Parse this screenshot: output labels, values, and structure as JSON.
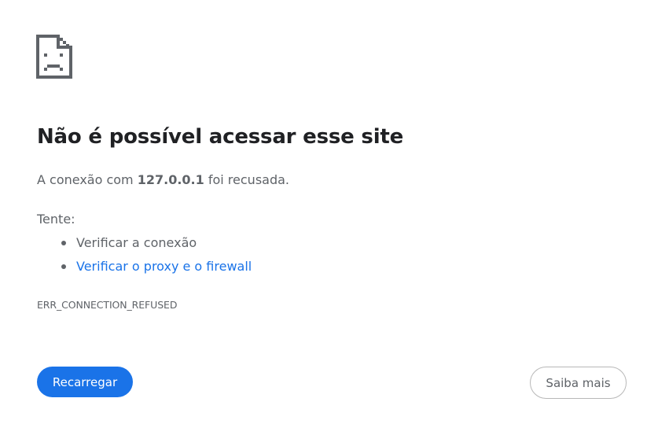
{
  "error_icon": "sad-page-icon",
  "heading": "Não é possível acessar esse site",
  "summary": {
    "prefix": "A conexão com ",
    "host": "127.0.0.1",
    "suffix": " foi recusada."
  },
  "try_label": "Tente:",
  "suggestions": [
    {
      "label": "Verificar a conexão",
      "is_link": false
    },
    {
      "label": "Verificar o proxy e o firewall",
      "is_link": true
    }
  ],
  "error_code": "ERR_CONNECTION_REFUSED",
  "buttons": {
    "reload": "Recarregar",
    "details": "Saiba mais"
  },
  "colors": {
    "accent": "#1a73e8",
    "text": "#5f6368",
    "heading": "#202124"
  }
}
